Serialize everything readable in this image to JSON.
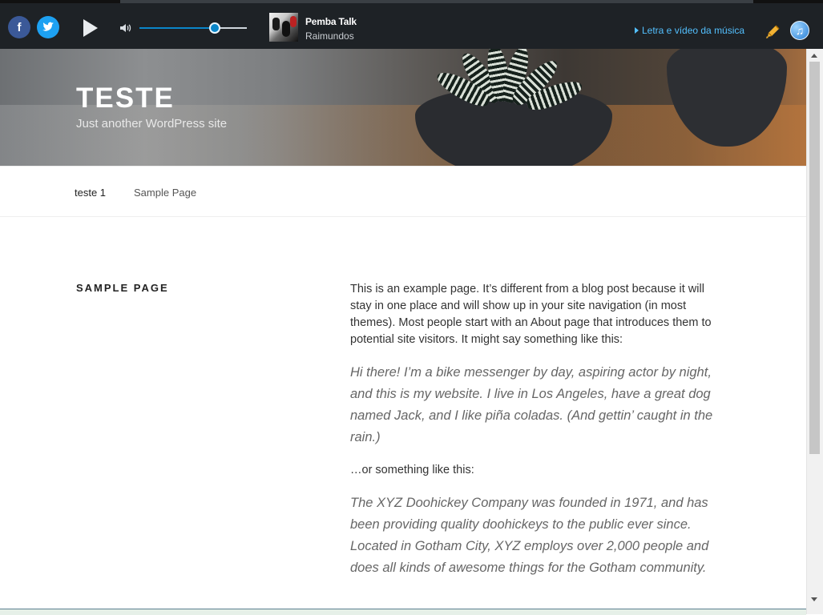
{
  "player": {
    "song": "Pemba Talk",
    "artist": "Raimundos",
    "lyrics_link": "Letra e vídeo da música",
    "volume": 0.7,
    "icons": [
      "facebook-icon",
      "twitter-icon",
      "play-icon",
      "volume-icon",
      "pen-icon",
      "itunes-icon"
    ],
    "colors": {
      "bar": "#1e2226",
      "accent": "#0a86c9",
      "link": "#53c0ff"
    }
  },
  "site": {
    "title": "TESTE",
    "tagline": "Just another WordPress site"
  },
  "nav": {
    "items": [
      {
        "label": "teste 1"
      },
      {
        "label": "Sample Page"
      }
    ]
  },
  "entry": {
    "title": "SAMPLE PAGE",
    "p1": "This is an example page. It’s different from a blog post because it will stay in one place and will show up in your site navigation (in most themes). Most people start with an About page that introduces them to potential site visitors. It might say something like this:",
    "quote1": "Hi there! I’m a bike messenger by day, aspiring actor by night, and this is my website. I live in Los Angeles, have a great dog named Jack, and I like piña coladas. (And gettin’ caught in the rain.)",
    "p2": "…or something like this:",
    "quote2": "The XYZ Doohickey Company was founded in 1971, and has been providing quality doohickeys to the public ever since. Located in Gotham City, XYZ employs over 2,000 people and does all kinds of awesome things for the Gotham community."
  }
}
